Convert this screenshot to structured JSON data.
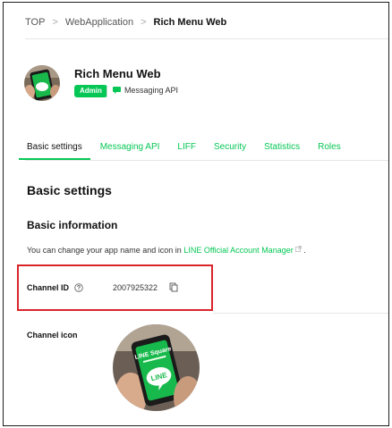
{
  "breadcrumb": {
    "items": [
      "TOP",
      "WebApplication"
    ],
    "current": "Rich Menu Web",
    "separator": ">"
  },
  "channel": {
    "name": "Rich Menu Web",
    "role_badge": "Admin",
    "type": "Messaging API"
  },
  "tabs": [
    {
      "label": "Basic settings",
      "active": true
    },
    {
      "label": "Messaging API",
      "active": false
    },
    {
      "label": "LIFF",
      "active": false
    },
    {
      "label": "Security",
      "active": false
    },
    {
      "label": "Statistics",
      "active": false
    },
    {
      "label": "Roles",
      "active": false
    }
  ],
  "main": {
    "section_title": "Basic settings",
    "subsection_title": "Basic information",
    "description_prefix": "You can change your app name and icon in ",
    "description_link": "LINE Official Account Manager",
    "description_suffix": " .",
    "channel_id_label": "Channel ID",
    "channel_id_value": "2007925322",
    "channel_icon_label": "Channel icon"
  },
  "channel_icon_image": {
    "brand_text": "LINE Square",
    "screen_text": "LINE"
  },
  "colors": {
    "accent": "#06c755",
    "highlight": "#d9252a"
  },
  "icons": {
    "help": "question-circle-icon",
    "copy": "copy-icon",
    "external": "external-link-icon",
    "api": "chat-bubble-icon"
  }
}
